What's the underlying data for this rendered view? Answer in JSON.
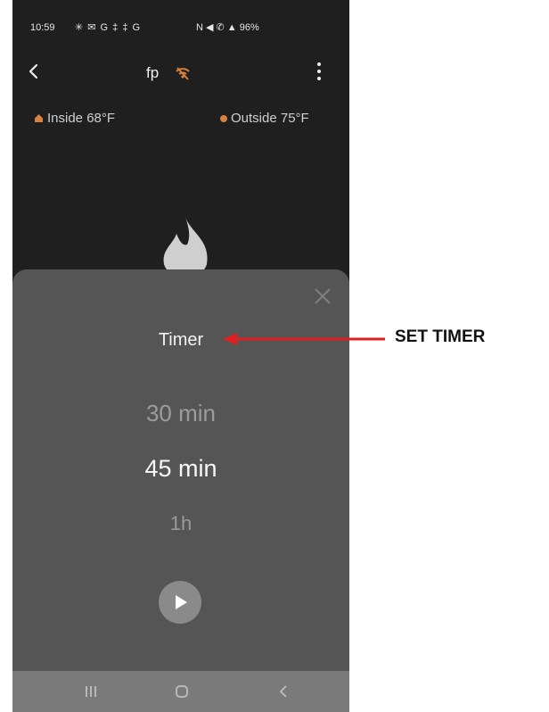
{
  "status_bar": {
    "time": "10:59",
    "icons_left": "✳ ✉ G ‡ ‡ G",
    "icons_right": "N ◀ ✆ ▲ 96%"
  },
  "header": {
    "back_icon": "chevron-left-icon",
    "title": "fp",
    "connection_icon": "wifi-off-icon",
    "menu_icon": "more-vertical-icon"
  },
  "temperatures": {
    "inside_label": "Inside 68°F",
    "outside_label": "Outside 75°F"
  },
  "timer_sheet": {
    "title": "Timer",
    "options": [
      "30 min",
      "45 min",
      "1h"
    ],
    "selected": "45 min",
    "close_icon": "close-icon",
    "play_icon": "play-icon"
  },
  "nav_bar": {
    "recents_icon": "recents-icon",
    "home_icon": "home-icon",
    "back_icon": "back-icon"
  },
  "annotation": {
    "label": "SET TIMER"
  },
  "colors": {
    "app_background": "#1f1f1f",
    "sheet_background": "#555555",
    "accent_orange": "#d8823e",
    "arrow_red": "#e02020"
  }
}
